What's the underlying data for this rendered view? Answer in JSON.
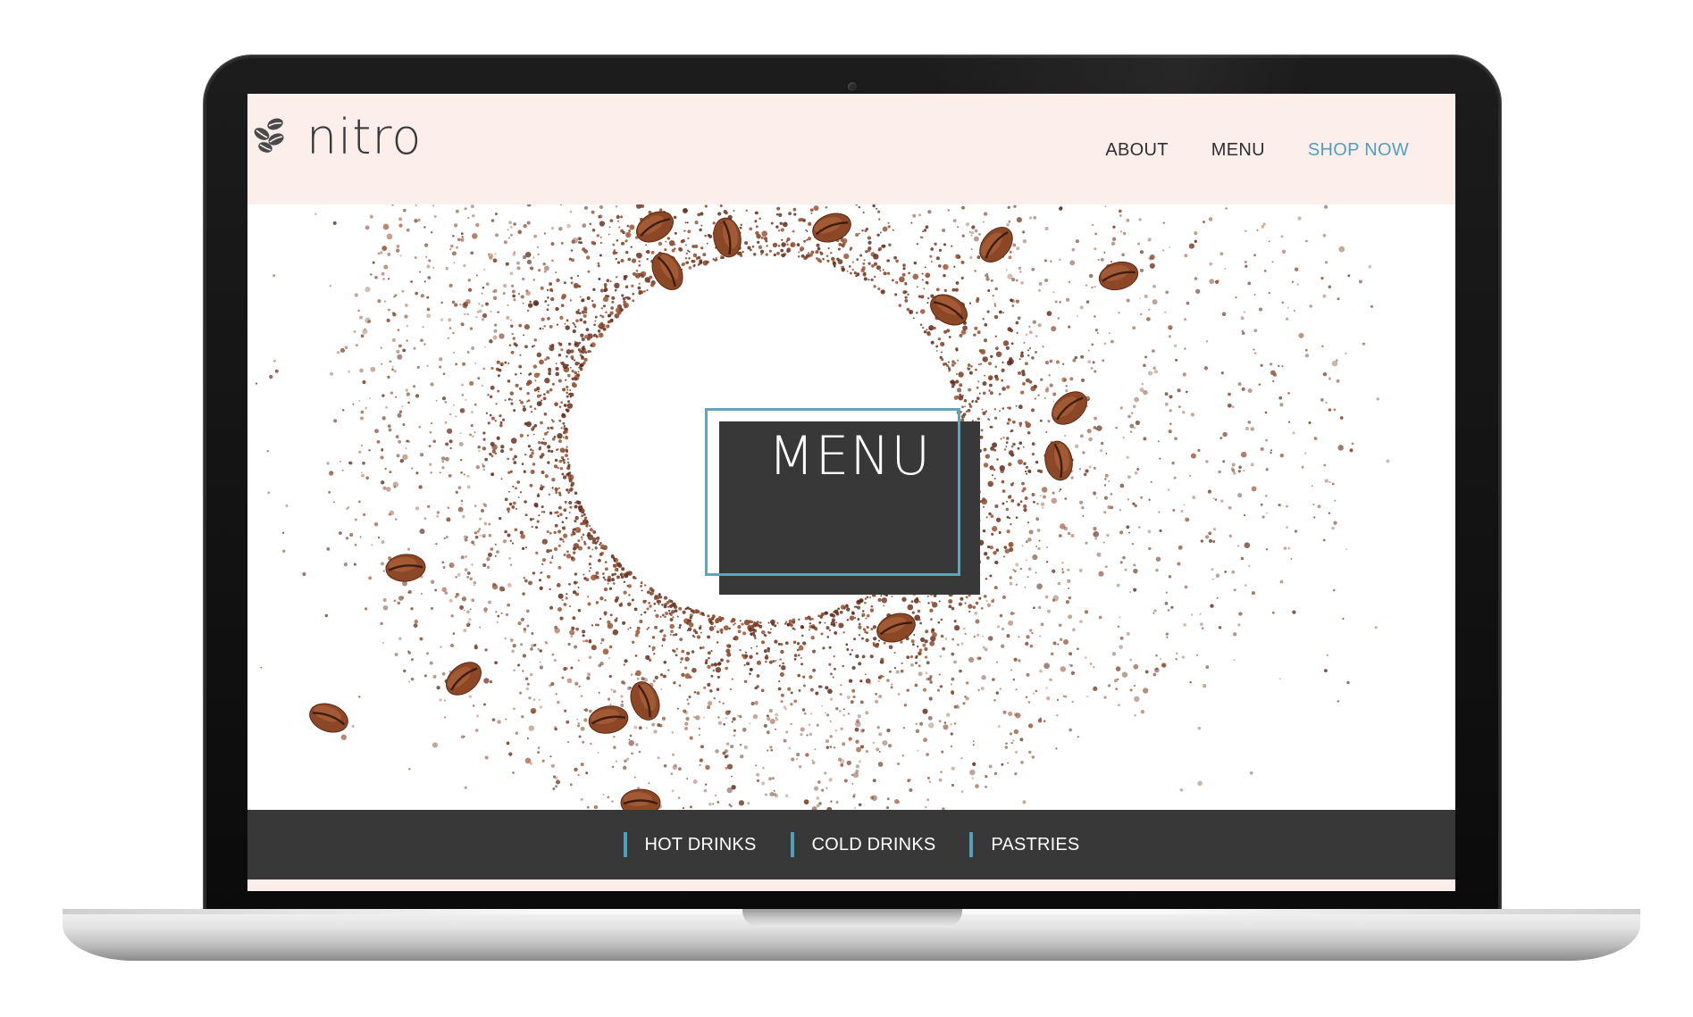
{
  "site": {
    "brand": "nitro",
    "logo_icon": "coffee-beans-icon"
  },
  "nav": {
    "items": [
      {
        "label": "ABOUT"
      },
      {
        "label": "MENU"
      },
      {
        "label": "SHOP NOW"
      }
    ],
    "accent_color": "#4f9fbd"
  },
  "hero": {
    "title": "MENU",
    "background": "coffee-grounds-ring-with-beans"
  },
  "categories": {
    "items": [
      {
        "label": "HOT DRINKS"
      },
      {
        "label": "COLD DRINKS"
      },
      {
        "label": "PASTRIES"
      }
    ]
  },
  "colors": {
    "header_bg": "#fcefeb",
    "dark": "#383838",
    "accent": "#4f9fbd",
    "coffee": "#7a3d24"
  }
}
